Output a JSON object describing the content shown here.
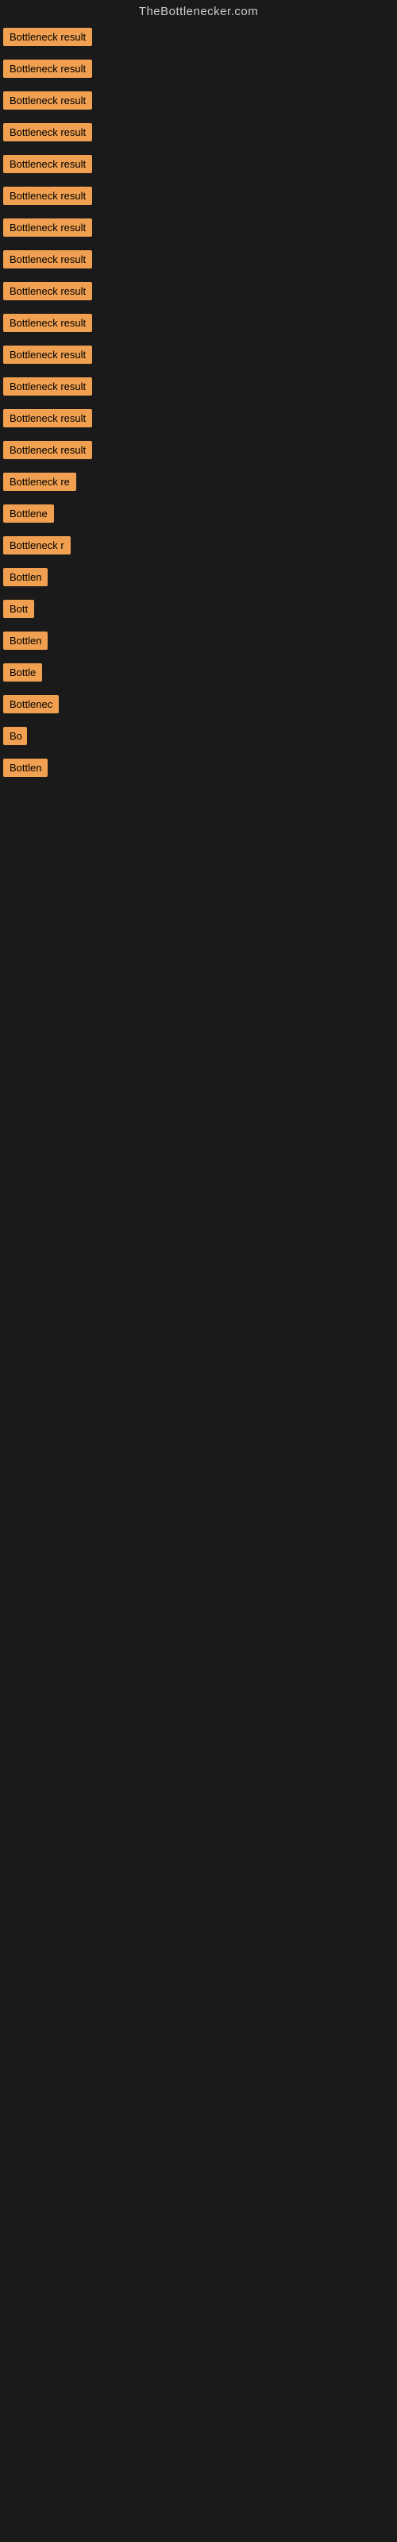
{
  "site": {
    "title": "TheBottlenecker.com"
  },
  "items": [
    {
      "label": "Bottleneck result",
      "width": 135
    },
    {
      "label": "Bottleneck result",
      "width": 135
    },
    {
      "label": "Bottleneck result",
      "width": 135
    },
    {
      "label": "Bottleneck result",
      "width": 135
    },
    {
      "label": "Bottleneck result",
      "width": 135
    },
    {
      "label": "Bottleneck result",
      "width": 135
    },
    {
      "label": "Bottleneck result",
      "width": 135
    },
    {
      "label": "Bottleneck result",
      "width": 135
    },
    {
      "label": "Bottleneck result",
      "width": 135
    },
    {
      "label": "Bottleneck result",
      "width": 135
    },
    {
      "label": "Bottleneck result",
      "width": 135
    },
    {
      "label": "Bottleneck result",
      "width": 135
    },
    {
      "label": "Bottleneck result",
      "width": 135
    },
    {
      "label": "Bottleneck result",
      "width": 135
    },
    {
      "label": "Bottleneck re",
      "width": 105
    },
    {
      "label": "Bottlene",
      "width": 80
    },
    {
      "label": "Bottleneck r",
      "width": 95
    },
    {
      "label": "Bottlen",
      "width": 75
    },
    {
      "label": "Bott",
      "width": 48
    },
    {
      "label": "Bottlen",
      "width": 75
    },
    {
      "label": "Bottle",
      "width": 62
    },
    {
      "label": "Bottlenec",
      "width": 88
    },
    {
      "label": "Bo",
      "width": 30
    },
    {
      "label": "Bottlen",
      "width": 72
    }
  ]
}
